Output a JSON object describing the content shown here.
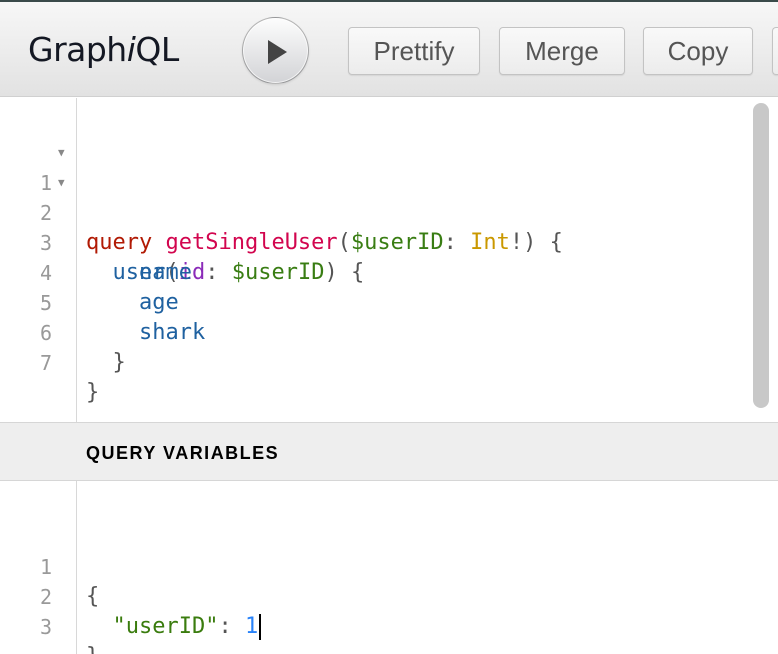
{
  "app": {
    "title_main": "Graph",
    "title_ital": "i",
    "title_end": "QL"
  },
  "toolbar": {
    "run_icon": "play-icon",
    "prettify_label": "Prettify",
    "merge_label": "Merge",
    "copy_label": "Copy"
  },
  "query_editor": {
    "lines": [
      {
        "n": "1",
        "fold": "▼"
      },
      {
        "n": "2",
        "fold": "▼"
      },
      {
        "n": "3",
        "fold": ""
      },
      {
        "n": "4",
        "fold": ""
      },
      {
        "n": "5",
        "fold": ""
      },
      {
        "n": "6",
        "fold": ""
      },
      {
        "n": "7",
        "fold": ""
      }
    ],
    "tokens": {
      "query": "query",
      "op_name": "getSingleUser",
      "open_paren": "(",
      "var_def": "$userID",
      "colon": ": ",
      "type": "Int",
      "bang_close": "!) {",
      "user_field": "user",
      "open_paren2": "(",
      "arg": "id",
      "colon2": ": ",
      "var_ref": "$userID",
      "close_brace_open": ") {",
      "name": "name",
      "age": "age",
      "shark": "shark",
      "inner_close": "}",
      "outer_close": "}"
    }
  },
  "variables": {
    "header": "QUERY VARIABLES",
    "lines": [
      {
        "n": "1"
      },
      {
        "n": "2"
      },
      {
        "n": "3"
      }
    ],
    "tokens": {
      "open": "{",
      "key": "\"userID\"",
      "colon": ": ",
      "value": "1",
      "close": "}"
    }
  },
  "colors": {
    "keyword": "#b11a04",
    "definition": "#d2054e",
    "variable": "#397d13",
    "type": "#ca9800",
    "property": "#1f61a0",
    "attribute": "#8b2bb9",
    "number": "#2882f9"
  }
}
